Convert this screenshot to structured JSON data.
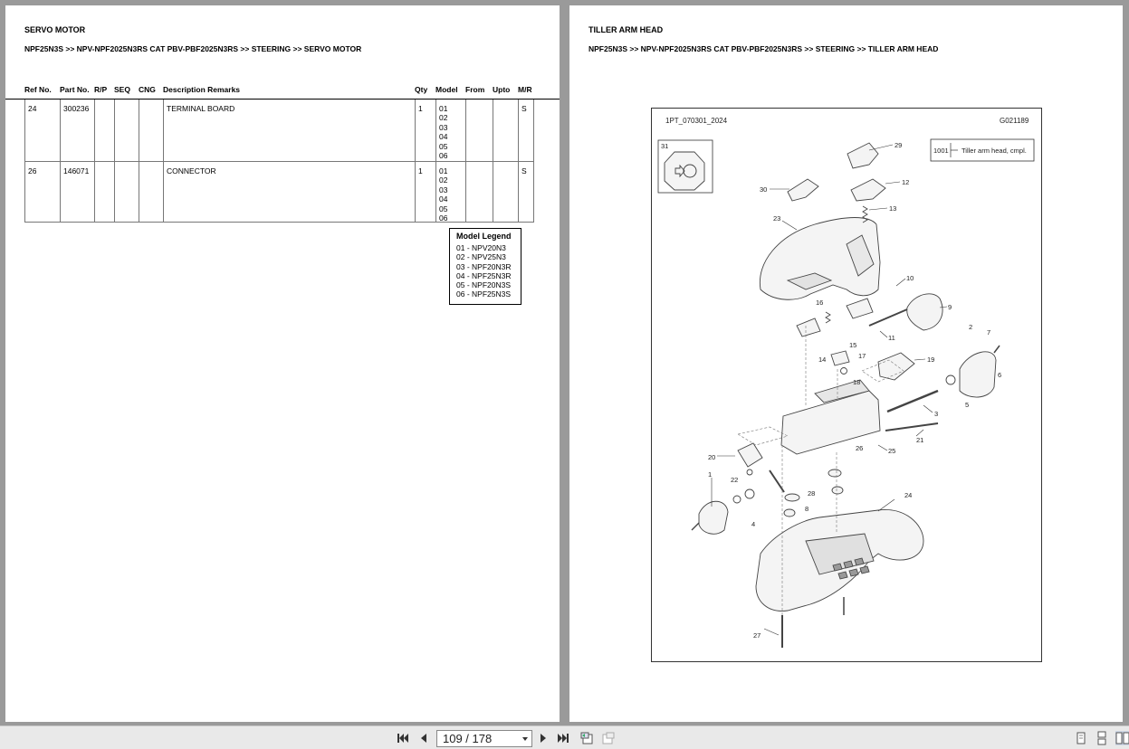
{
  "left_page": {
    "title": "SERVO MOTOR",
    "breadcrumb": "NPF25N3S >> NPV-NPF2025N3RS CAT PBV-PBF2025N3RS >> STEERING >> SERVO MOTOR",
    "table": {
      "headers": {
        "ref_no": "Ref No.",
        "part_no": "Part No.",
        "rp": "R/P",
        "seq": "SEQ",
        "cng": "CNG",
        "description": "Description Remarks",
        "qty": "Qty",
        "model": "Model",
        "from": "From",
        "upto": "Upto",
        "mr": "M/R"
      },
      "rows": [
        {
          "ref_no": "24",
          "part_no": "300236",
          "description": "TERMINAL BOARD",
          "qty": "1",
          "models": [
            "01",
            "02",
            "03",
            "04",
            "05",
            "06"
          ],
          "mr": "S"
        },
        {
          "ref_no": "26",
          "part_no": "146071",
          "description": "CONNECTOR",
          "qty": "1",
          "models": [
            "01",
            "02",
            "03",
            "04",
            "05",
            "06"
          ],
          "mr": "S"
        }
      ]
    },
    "model_legend": {
      "title": "Model Legend",
      "items": [
        "01 - NPV20N3",
        "02 - NPV25N3",
        "03 - NPF20N3R",
        "04 - NPF25N3R",
        "05 - NPF20N3S",
        "06 - NPF25N3S"
      ]
    }
  },
  "right_page": {
    "title": "TILLER ARM HEAD",
    "breadcrumb": "NPF25N3S >> NPV-NPF2025N3RS CAT PBV-PBF2025N3RS >> STEERING >> TILLER ARM HEAD",
    "diagram": {
      "doc_code": "1PT_070301_2024",
      "figure_code": "G021189",
      "assembly_callout_ref": "1001",
      "assembly_callout_text": "Tiller arm head, cmpl.",
      "inset_ref": "31",
      "part_labels": [
        "1",
        "2",
        "3",
        "4",
        "5",
        "6",
        "7",
        "8",
        "9",
        "10",
        "11",
        "12",
        "13",
        "14",
        "15",
        "16",
        "17",
        "18",
        "19",
        "20",
        "21",
        "22",
        "23",
        "24",
        "25",
        "26",
        "27",
        "28",
        "29",
        "30"
      ]
    }
  },
  "toolbar": {
    "page_indicator": "109 / 178",
    "current_page": 109,
    "total_pages": 178
  }
}
